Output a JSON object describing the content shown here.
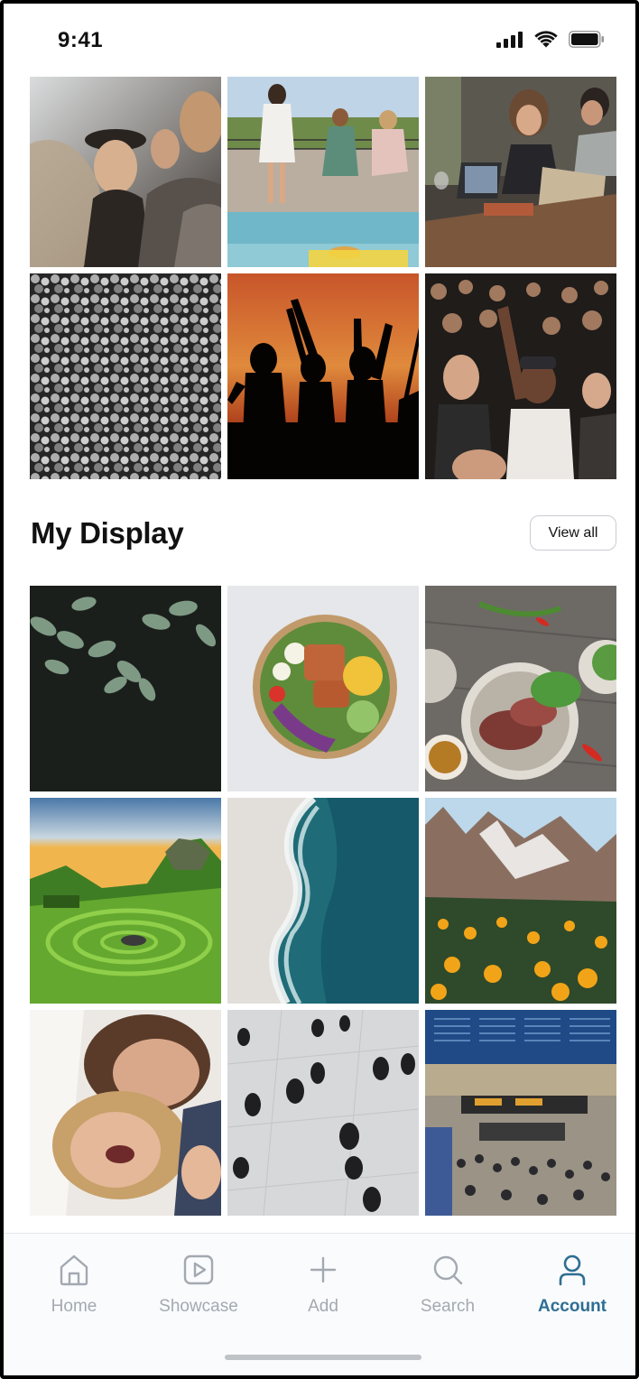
{
  "status_bar": {
    "time": "9:41"
  },
  "top_gallery": {
    "photos": [
      {
        "icon": "friends-laughing-photo"
      },
      {
        "icon": "poolside-friends-photo"
      },
      {
        "icon": "laptop-meeting-photo"
      },
      {
        "icon": "bw-crowd-photo"
      },
      {
        "icon": "sunset-silhouettes-photo"
      },
      {
        "icon": "concert-crowd-photo"
      }
    ]
  },
  "section": {
    "title": "My Display",
    "view_all_label": "View all"
  },
  "display_gallery": {
    "photos": [
      {
        "icon": "dark-leaves-photo"
      },
      {
        "icon": "salad-bowl-photo"
      },
      {
        "icon": "steak-plate-photo"
      },
      {
        "icon": "green-valley-photo"
      },
      {
        "icon": "ocean-shore-photo"
      },
      {
        "icon": "mountain-flowers-photo"
      },
      {
        "icon": "couple-laughing-photo"
      },
      {
        "icon": "walking-people-photo"
      },
      {
        "icon": "train-station-photo"
      }
    ]
  },
  "tab_bar": {
    "tabs": [
      {
        "label": "Home",
        "icon": "home-icon"
      },
      {
        "label": "Showcase",
        "icon": "play-square-icon"
      },
      {
        "label": "Add",
        "icon": "plus-icon"
      },
      {
        "label": "Search",
        "icon": "search-icon"
      },
      {
        "label": "Account",
        "icon": "user-icon",
        "active": true
      }
    ]
  },
  "colors": {
    "accent": "#2e6e93",
    "inactive": "#a3a9b1"
  }
}
